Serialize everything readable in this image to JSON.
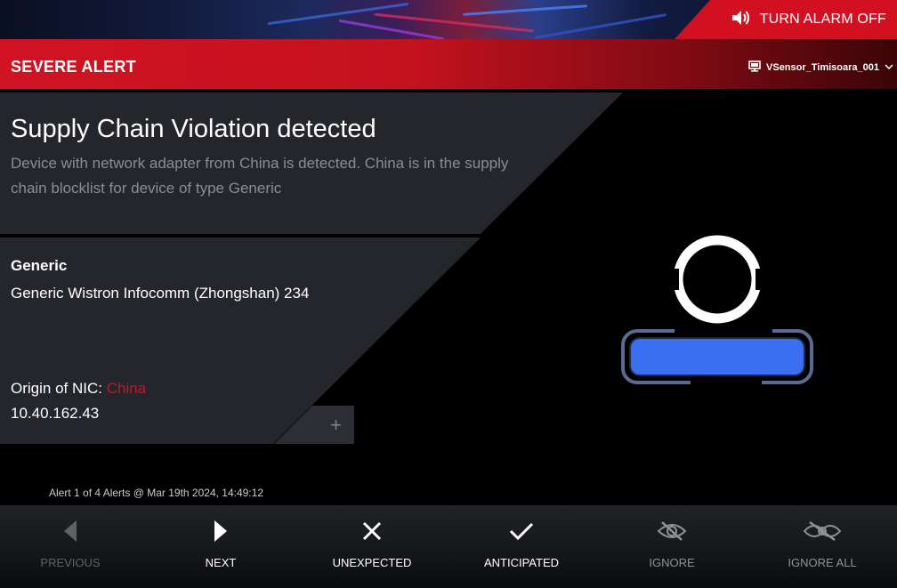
{
  "banner": {
    "alarm_off_label": "TURN ALARM OFF",
    "alarm_icon": "speaker-icon"
  },
  "header": {
    "severity_label": "SEVERE ALERT",
    "sensor_name": "VSensor_Timisoara_001",
    "sensor_icon": "network-sensor-icon"
  },
  "alert": {
    "title": "Supply Chain Violation detected",
    "description": "Device with network adapter from China is detected. China is in the supply chain blocklist for device of type Generic"
  },
  "device": {
    "type": "Generic",
    "model": "Generic Wistron Infocomm (Zhongshan) 234",
    "origin_label": "Origin of NIC:",
    "origin_value": "China",
    "ip": "10.40.162.43",
    "expand_icon": "plus-icon"
  },
  "footer": {
    "alert_count": "Alert 1 of 4 Alerts @ Mar 19th 2024, 14:49:12",
    "actions": [
      {
        "label": "PREVIOUS",
        "icon": "triangle-left-icon",
        "state": "disabled"
      },
      {
        "label": "NEXT",
        "icon": "triangle-right-icon",
        "state": "active"
      },
      {
        "label": "UNEXPECTED",
        "icon": "x-icon",
        "state": "active"
      },
      {
        "label": "ANTICIPATED",
        "icon": "checkmark-icon",
        "state": "active"
      },
      {
        "label": "IGNORE",
        "icon": "eye-slash-icon",
        "state": "dim"
      },
      {
        "label": "IGNORE ALL",
        "icon": "double-eye-slash-icon",
        "state": "dim"
      }
    ]
  },
  "colors": {
    "alert_red": "#d3101f",
    "card_bg": "#24262b",
    "device_blue": "#3b6ff0",
    "muted_text": "#8a8d93"
  }
}
